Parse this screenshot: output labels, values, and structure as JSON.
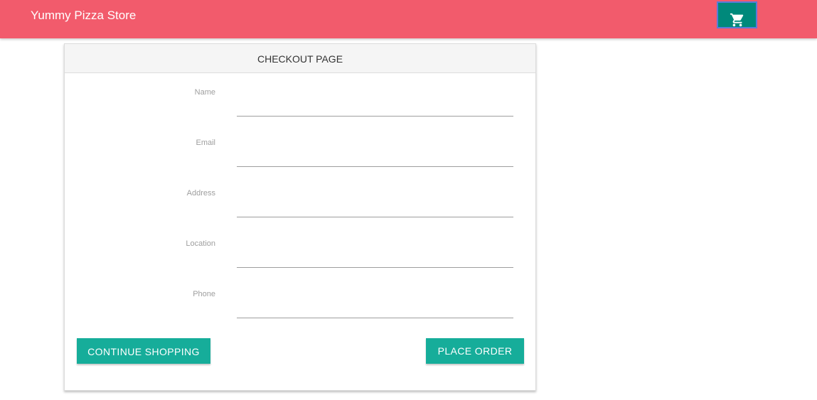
{
  "header": {
    "brand": "Yummy Pizza Store",
    "cart_icon": "shopping-cart-icon"
  },
  "checkout": {
    "title": "CHECKOUT PAGE",
    "fields": [
      {
        "label": "Name",
        "value": "",
        "placeholder": ""
      },
      {
        "label": "Email",
        "value": "",
        "placeholder": ""
      },
      {
        "label": "Address",
        "value": "",
        "placeholder": ""
      },
      {
        "label": "Location",
        "value": "",
        "placeholder": ""
      },
      {
        "label": "Phone",
        "value": "",
        "placeholder": ""
      }
    ],
    "continue_label": "CONTINUE SHOPPING",
    "place_order_label": "PLACE ORDER"
  },
  "colors": {
    "navbar": "#f25b6c",
    "cart_button": "#00897b",
    "button_accent": "#16ad9a"
  }
}
